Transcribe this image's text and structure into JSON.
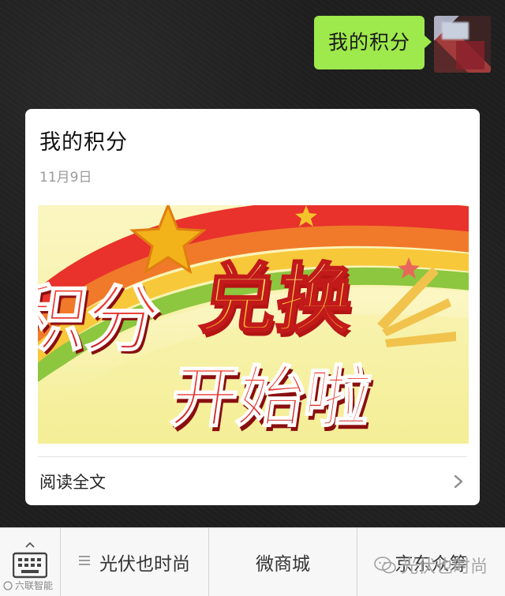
{
  "chat": {
    "user_message": "我的积分"
  },
  "article": {
    "title": "我的积分",
    "date": "11月9日",
    "banner": {
      "line1_left": "积分",
      "line1_right": "兑换",
      "line2": "开始啦"
    },
    "read_more": "阅读全文"
  },
  "menu": {
    "items": [
      {
        "label": "光伏也时尚",
        "has_submenu": true
      },
      {
        "label": "微商城",
        "has_submenu": false
      },
      {
        "label": "京东众筹",
        "has_submenu": false
      }
    ]
  },
  "watermark": {
    "text": "光伏也时尚",
    "corner": "六联智能"
  },
  "colors": {
    "bubble": "#9ee94b",
    "banner_red": "#d8262b",
    "banner_yellow": "#f5f2a8",
    "star": "#f2b21a"
  },
  "icons": {
    "keyboard": "keyboard-icon",
    "menu_lines": "menu-lines-icon",
    "chevron": "chevron-right-icon",
    "watermark": "wechat-logo-icon"
  }
}
